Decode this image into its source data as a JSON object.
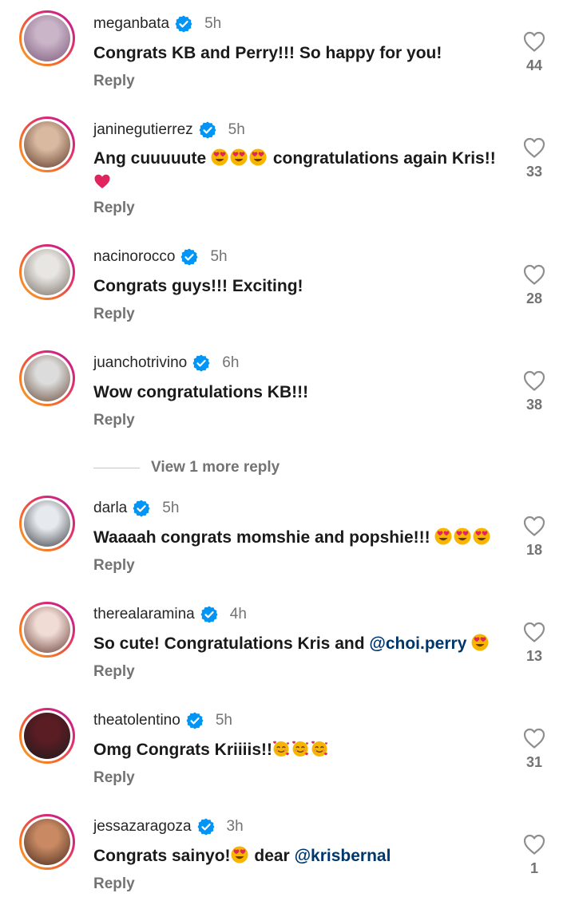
{
  "colors": {
    "accent_blue": "#0095f6",
    "mention_blue": "#00376b",
    "ring_gradient": [
      "#f9a825",
      "#f46b2b",
      "#e1306c",
      "#b5179e"
    ],
    "muted_text": "#737373"
  },
  "icons": {
    "verified": "verified-badge-icon",
    "like": "heart-outline-icon",
    "emoji_heart_eyes": "smiling-face-with-heart-eyes",
    "emoji_red_heart": "red-heart",
    "emoji_hearts": "smiling-face-with-hearts"
  },
  "view_more_replies": "View 1 more reply",
  "comments": [
    {
      "username": "meganbata",
      "time": "5h",
      "text": "Congrats KB and Perry!!! So happy for you!",
      "reply": "Reply",
      "likes": "44",
      "avatar_colors": [
        "#c9b4c8",
        "#7d5a7a"
      ]
    },
    {
      "username": "janinegutierrez",
      "time": "5h",
      "text_1": "Ang cuuuuute",
      "text_2": "congratulations again Kris!!",
      "reply": "Reply",
      "likes": "33",
      "avatar_colors": [
        "#d9b9a0",
        "#5e3a2b"
      ]
    },
    {
      "username": "nacinorocco",
      "time": "5h",
      "text": "Congrats guys!!! Exciting!",
      "reply": "Reply",
      "likes": "28",
      "avatar_colors": [
        "#e8e6e2",
        "#7a6f68"
      ]
    },
    {
      "username": "juanchotrivino",
      "time": "6h",
      "text": "Wow congratulations KB!!!",
      "reply": "Reply",
      "likes": "38",
      "avatar_colors": [
        "#dcdcdc",
        "#6b4e3d"
      ]
    },
    {
      "username": "darla",
      "time": "5h",
      "text": "Waaaah congrats momshie and popshie!!!",
      "reply": "Reply",
      "likes": "18",
      "avatar_colors": [
        "#e6eaee",
        "#3d3f44"
      ]
    },
    {
      "username": "therealaramina",
      "time": "4h",
      "text": "So cute! Congratulations Kris and",
      "mention": "@choi.perry",
      "reply": "Reply",
      "likes": "13",
      "avatar_colors": [
        "#f0dcd4",
        "#6b3f3a"
      ]
    },
    {
      "username": "theatolentino",
      "time": "5h",
      "text": "Omg Congrats Kriiiis!!",
      "reply": "Reply",
      "likes": "31",
      "avatar_colors": [
        "#5b1d24",
        "#1e1a1c"
      ]
    },
    {
      "username": "jessazaragoza",
      "time": "3h",
      "text_1": "Congrats sainyo!",
      "text_2": "dear",
      "mention": "@krisbernal",
      "reply": "Reply",
      "likes": "1",
      "avatar_colors": [
        "#c98a63",
        "#4a2c20"
      ]
    }
  ]
}
